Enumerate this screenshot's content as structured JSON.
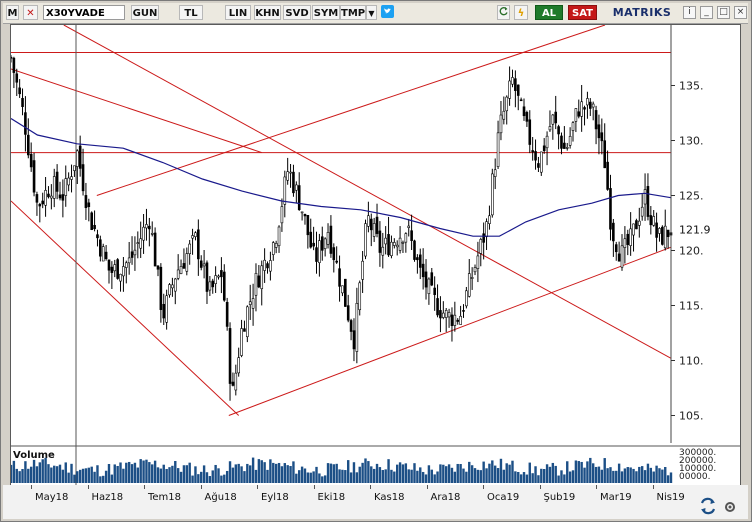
{
  "toolbar": {
    "m_label": "M",
    "symbol": "X30YVADE",
    "buttons": [
      "GUN",
      "TL",
      "LIN",
      "KHN",
      "SVD",
      "SYM",
      "TMP"
    ],
    "buy_label": "AL",
    "sell_label": "SAT",
    "logo": "MATRIKS"
  },
  "icons": {
    "close": "close-icon",
    "dropdown": "chevron-down-icon",
    "twitter": "twitter-icon",
    "refresh": "refresh-icon",
    "lightning": "lightning-icon",
    "info": "info-icon",
    "settings": "settings-icon",
    "bottom": "swap-icon"
  },
  "colors": {
    "candle": "#000000",
    "moving_average": "#1a1a8c",
    "trendline": "#cc1a1a",
    "volume": "#1c4f86",
    "buy": "#1f7a2a",
    "sell": "#c41818"
  },
  "chart_data": {
    "type": "candlestick",
    "y_ticks": [
      "135.",
      "130.",
      "125.",
      "120.",
      "115.",
      "110.",
      "105."
    ],
    "y_tick_values": [
      135,
      130,
      125,
      120,
      115,
      110,
      105
    ],
    "last_price_label": "121.9",
    "last_price": 121.9,
    "ylim": [
      102.5,
      140.5
    ],
    "x_labels": [
      "May18",
      "Haz18",
      "Tem18",
      "Ağu18",
      "Eyl18",
      "Eki18",
      "Kas18",
      "Ara18",
      "Oca19",
      "Şub19",
      "Mar19",
      "Nis19"
    ],
    "horizontal_lines": [
      138.0,
      128.9
    ],
    "volume": {
      "label": "Volume",
      "tick_labels": [
        "300000.",
        "200000.",
        "100000.",
        "00000."
      ]
    },
    "ma_points": [
      [
        0,
        132.0
      ],
      [
        0.04,
        130.5
      ],
      [
        0.1,
        129.7
      ],
      [
        0.17,
        129.3
      ],
      [
        0.23,
        128.0
      ],
      [
        0.29,
        126.5
      ],
      [
        0.35,
        125.4
      ],
      [
        0.41,
        124.5
      ],
      [
        0.47,
        124.0
      ],
      [
        0.53,
        123.7
      ],
      [
        0.59,
        123.0
      ],
      [
        0.65,
        122.0
      ],
      [
        0.7,
        121.3
      ],
      [
        0.74,
        121.3
      ],
      [
        0.78,
        122.6
      ],
      [
        0.83,
        123.7
      ],
      [
        0.88,
        124.3
      ],
      [
        0.92,
        125.0
      ],
      [
        0.96,
        125.2
      ],
      [
        1.0,
        124.8
      ]
    ],
    "close_path": [
      [
        0,
        137.5
      ],
      [
        0.02,
        132
      ],
      [
        0.04,
        124
      ],
      [
        0.06,
        126
      ],
      [
        0.08,
        125
      ],
      [
        0.1,
        129
      ],
      [
        0.12,
        123
      ],
      [
        0.15,
        118
      ],
      [
        0.18,
        119
      ],
      [
        0.21,
        123
      ],
      [
        0.23,
        114
      ],
      [
        0.25,
        118
      ],
      [
        0.28,
        121
      ],
      [
        0.3,
        116
      ],
      [
        0.32,
        118
      ],
      [
        0.335,
        106.5
      ],
      [
        0.35,
        113
      ],
      [
        0.37,
        117
      ],
      [
        0.4,
        121
      ],
      [
        0.42,
        127.5
      ],
      [
        0.44,
        124
      ],
      [
        0.46,
        119
      ],
      [
        0.48,
        122
      ],
      [
        0.5,
        117
      ],
      [
        0.52,
        112
      ],
      [
        0.54,
        123
      ],
      [
        0.56,
        120
      ],
      [
        0.58,
        121
      ],
      [
        0.6,
        122
      ],
      [
        0.62,
        118
      ],
      [
        0.64,
        115.5
      ],
      [
        0.66,
        114
      ],
      [
        0.68,
        114
      ],
      [
        0.7,
        118
      ],
      [
        0.72,
        122
      ],
      [
        0.74,
        131
      ],
      [
        0.76,
        135.5
      ],
      [
        0.78,
        131
      ],
      [
        0.8,
        128
      ],
      [
        0.82,
        132
      ],
      [
        0.84,
        129
      ],
      [
        0.86,
        133
      ],
      [
        0.88,
        133
      ],
      [
        0.9,
        128
      ],
      [
        0.91,
        122
      ],
      [
        0.925,
        119.5
      ],
      [
        0.94,
        121
      ],
      [
        0.96,
        125
      ],
      [
        0.98,
        121
      ],
      [
        1.0,
        121.9
      ]
    ]
  }
}
